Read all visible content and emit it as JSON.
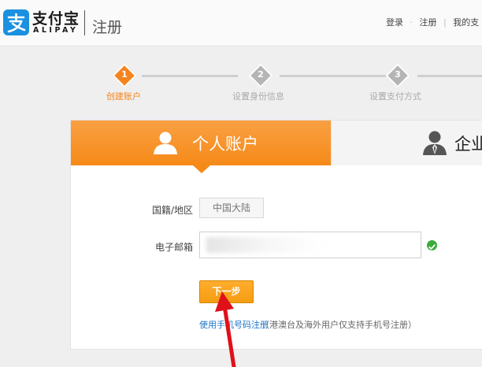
{
  "header": {
    "logo_cn": "支付宝",
    "logo_en": "ALIPAY",
    "page_label": "注册",
    "links": [
      "登录",
      "注册",
      "我的支"
    ]
  },
  "steps": [
    {
      "num": "1",
      "label": "创建账户",
      "active": true
    },
    {
      "num": "2",
      "label": "设置身份信息",
      "active": false
    },
    {
      "num": "3",
      "label": "设置支付方式",
      "active": false
    }
  ],
  "tabs": {
    "personal": "个人账户",
    "business": "企业"
  },
  "form": {
    "country_label": "国籍/地区",
    "country_value": "中国大陆",
    "email_label": "电子邮箱",
    "email_value": "",
    "next_button": "下一步",
    "phone_link": "使用手机号码注册",
    "phone_note": "（港澳台及海外用户仅支持手机号注册）"
  },
  "colors": {
    "accent": "#f68a18",
    "brand": "#1a90e0",
    "link": "#1c73c9",
    "valid": "#3aab3a"
  },
  "icons": {
    "logo": "alipay-logo-icon",
    "personal": "user-icon",
    "business": "business-user-icon",
    "valid": "check-icon",
    "annotation": "red-arrow-icon"
  }
}
